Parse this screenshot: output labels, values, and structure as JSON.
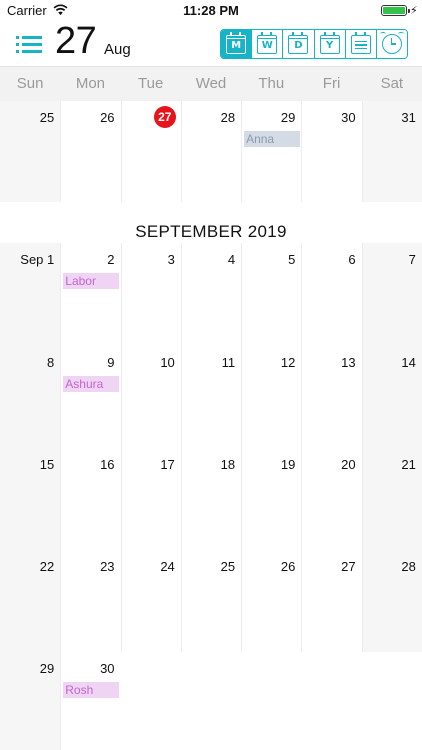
{
  "status_bar": {
    "carrier": "Carrier",
    "time": "11:28 PM",
    "battery_level": 1.0,
    "icons": [
      "wifi-icon",
      "battery-icon",
      "charging-icon"
    ]
  },
  "header": {
    "day": "27",
    "month": "Aug",
    "menu_icon": "list-icon",
    "view_buttons": [
      {
        "letter": "M",
        "name": "month",
        "active": true
      },
      {
        "letter": "W",
        "name": "week",
        "active": false
      },
      {
        "letter": "D",
        "name": "day",
        "active": false
      },
      {
        "letter": "Y",
        "name": "year",
        "active": false
      },
      {
        "letter": "",
        "name": "agenda",
        "active": false
      },
      {
        "letter": "",
        "name": "alarm",
        "active": false
      }
    ]
  },
  "weekdays": [
    "Sun",
    "Mon",
    "Tue",
    "Wed",
    "Thu",
    "Fri",
    "Sat"
  ],
  "august_week": {
    "days": [
      "25",
      "26",
      "27",
      "28",
      "29",
      "30",
      "31"
    ],
    "today_index": 2,
    "events": [
      {
        "day_index": 4,
        "label": "Anna",
        "color": "grey"
      }
    ]
  },
  "september": {
    "title": "SEPTEMBER 2019",
    "weeks": [
      {
        "days": [
          "Sep 1",
          "2",
          "3",
          "4",
          "5",
          "6",
          "7"
        ],
        "events": [
          {
            "day_index": 1,
            "label": "Labor",
            "color": "purple"
          }
        ]
      },
      {
        "days": [
          "8",
          "9",
          "10",
          "11",
          "12",
          "13",
          "14"
        ],
        "events": [
          {
            "day_index": 1,
            "label": "Ashura",
            "color": "purple"
          }
        ]
      },
      {
        "days": [
          "15",
          "16",
          "17",
          "18",
          "19",
          "20",
          "21"
        ],
        "events": []
      },
      {
        "days": [
          "22",
          "23",
          "24",
          "25",
          "26",
          "27",
          "28"
        ],
        "events": []
      },
      {
        "days": [
          "29",
          "30",
          "",
          "",
          "",
          "",
          ""
        ],
        "events": [
          {
            "day_index": 1,
            "label": "Rosh",
            "color": "purple"
          }
        ]
      }
    ]
  },
  "colors": {
    "accent": "#17b3c6",
    "today": "#e8141b",
    "event_grey_bg": "#d4dbe4",
    "event_purple_bg": "#f0d4f4",
    "event_purple_text": "#c067cf",
    "weekend_bg": "#f6f6f6"
  }
}
